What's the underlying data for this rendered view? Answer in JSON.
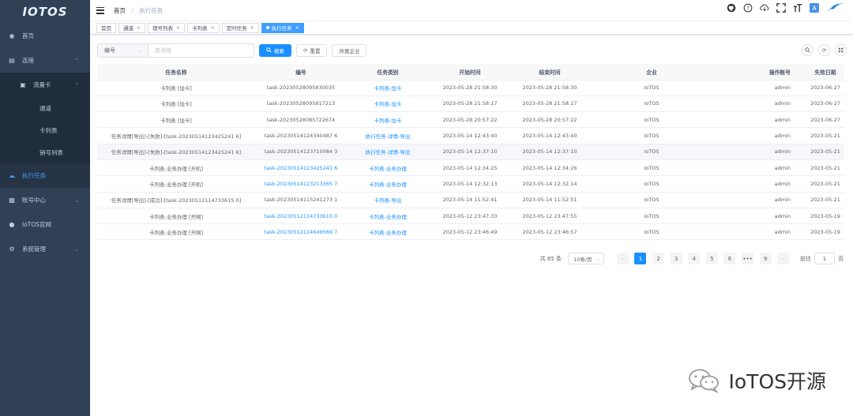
{
  "app": {
    "logo": "IOTOS"
  },
  "sidebar": {
    "items": [
      {
        "label": "首页",
        "icon": "dashboard-icon"
      },
      {
        "label": "连接",
        "icon": "connection-icon"
      },
      {
        "label": "流量卡",
        "icon": "sim-card-icon"
      },
      {
        "label": "通道"
      },
      {
        "label": "卡列表"
      },
      {
        "label": "销号列表"
      },
      {
        "label": "执行任务",
        "icon": "cloud-task-icon"
      },
      {
        "label": "账号中心",
        "icon": "account-icon"
      },
      {
        "label": "IoTOS官网",
        "icon": "globe-icon"
      },
      {
        "label": "系统管理",
        "icon": "gear-icon"
      }
    ]
  },
  "breadcrumb": {
    "home": "首页",
    "sep": "/",
    "current": "执行任务"
  },
  "tags": [
    {
      "label": "首页"
    },
    {
      "label": "通道"
    },
    {
      "label": "销号列表"
    },
    {
      "label": "卡列表"
    },
    {
      "label": "定时任务"
    },
    {
      "label": "执行任务"
    }
  ],
  "search": {
    "select_value": "编号",
    "input_placeholder": "查询值",
    "search_label": "搜索",
    "reset_label": "重置",
    "company_label": "所属企业"
  },
  "table": {
    "columns": [
      "任务名称",
      "编号",
      "任务类别",
      "开始时间",
      "结束时间",
      "企业",
      "操作账号",
      "失效日期"
    ],
    "rows": [
      [
        "卡列表 [加卡]",
        "task-20230528095830035",
        "卡列表-加卡",
        "2023-05-28 21:58:30",
        "2023-05-28 21:58:30",
        "IoTOS",
        "admin",
        "2023-06-27"
      ],
      [
        "卡列表 [加卡]",
        "task-20230528095817213",
        "卡列表-加卡",
        "2023-05-28 21:58:17",
        "2023-05-28 21:58:17",
        "IoTOS",
        "admin",
        "2023-06-27"
      ],
      [
        "卡列表 [加卡]",
        "task-20230528085722674",
        "卡列表-加卡",
        "2023-05-28 20:57:22",
        "2023-05-28 20:57:22",
        "IoTOS",
        "admin",
        "2023-06-27"
      ],
      [
        "任务详情[导出]-[失败]-[task-20230514123425241 6]",
        "task-20230514124340487 6",
        "执行任务-详情-导出",
        "2023-05-14 12:43:40",
        "2023-05-14 12:43:40",
        "IoTOS",
        "admin",
        "2023-05-21"
      ],
      [
        "任务详情[导出]-[失败]-[task-20230514123425241 6]",
        "task-20230514123710084 3",
        "执行任务-详情-导出",
        "2023-05-14 12:37:10",
        "2023-05-14 12:37:10",
        "IoTOS",
        "admin",
        "2023-05-21"
      ],
      [
        "卡列表-业务办理 [开机]",
        "task-20230514123425241 6",
        "卡列表-业务办理",
        "2023-05-14 12:34:25",
        "2023-05-14 12:34:26",
        "IoTOS",
        "admin",
        "2023-05-21"
      ],
      [
        "卡列表-业务办理 [开机]",
        "task-20230514123213365 7",
        "卡列表-业务办理",
        "2023-05-14 12:32:13",
        "2023-05-14 12:32:14",
        "IoTOS",
        "admin",
        "2023-05-21"
      ],
      [
        "任务详情[导出]-[成功]-[task-20230512114733615 0]",
        "task-20230514115241273 1",
        "卡列表-导出",
        "2023-05-14 11:52:41",
        "2023-05-14 11:52:51",
        "IoTOS",
        "admin",
        "2023-05-21"
      ],
      [
        "卡列表-业务办理 [开网]",
        "task-20230512114733615 0",
        "卡列表-业务办理",
        "2023-05-12 23:47:33",
        "2023-05-12 23:47:55",
        "IoTOS",
        "admin",
        "2023-05-19"
      ],
      [
        "卡列表-业务办理 [开网]",
        "task-20230512114649569 7",
        "卡列表-业务办理",
        "2023-05-12 23:46:49",
        "2023-05-12 23:46:57",
        "IoTOS",
        "admin",
        "2023-05-19"
      ]
    ]
  },
  "pagination": {
    "total": "共 85 条",
    "page_size": "10条/页",
    "pages": [
      "1",
      "2",
      "3",
      "4",
      "5",
      "6",
      "•••",
      "9"
    ],
    "current": "1",
    "goto_label": "前往",
    "goto_value": "1",
    "page_unit": "页"
  },
  "watermark": {
    "text": "IoTOS开源"
  },
  "colors": {
    "sidebar": "#304156",
    "primary": "#1890ff",
    "active_menu": "#409eff"
  }
}
